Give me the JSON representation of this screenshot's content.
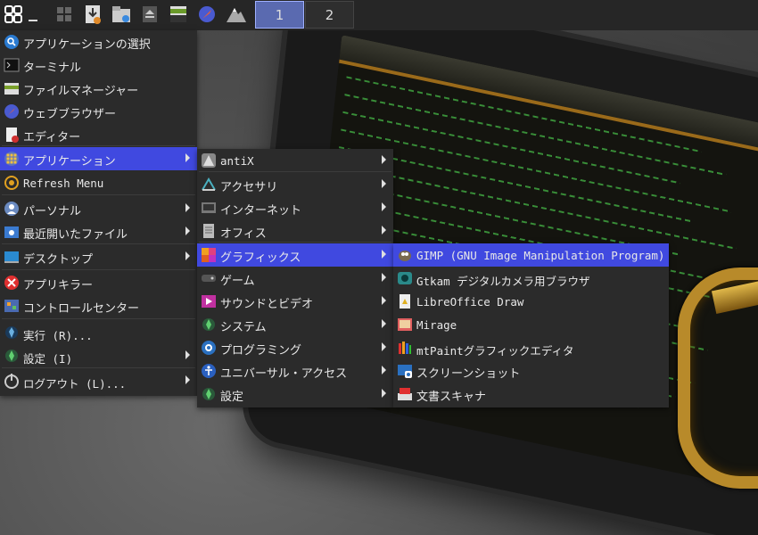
{
  "taskbar": {
    "launchers": [
      "menu-icon",
      "show-desktop-icon",
      "download-icon",
      "file-manager-icon",
      "eject-icon",
      "terminal-icon",
      "browser-icon",
      "mountain-icon"
    ],
    "desktops": [
      "1",
      "2"
    ],
    "active_desktop": "1"
  },
  "main_menu": {
    "items": [
      {
        "label": "アプリケーションの選択",
        "icon": "search-icon",
        "submenu": false
      },
      {
        "label": "ターミナル",
        "icon": "terminal-icon",
        "submenu": false
      },
      {
        "label": "ファイルマネージャー",
        "icon": "file-manager-icon",
        "submenu": false
      },
      {
        "label": "ウェブブラウザー",
        "icon": "web-browser-icon",
        "submenu": false
      },
      {
        "label": "エディター",
        "icon": "editor-icon",
        "submenu": false
      },
      {
        "label": "アプリケーション",
        "icon": "applications-icon",
        "submenu": true,
        "highlighted": true
      },
      {
        "label": "Refresh Menu",
        "icon": "refresh-icon",
        "submenu": false
      },
      {
        "label": "パーソナル",
        "icon": "personal-icon",
        "submenu": true
      },
      {
        "label": "最近開いたファイル",
        "icon": "recent-files-icon",
        "submenu": true
      },
      {
        "label": "デスクトップ",
        "icon": "desktop-icon",
        "submenu": true
      },
      {
        "label": "アプリキラー",
        "icon": "app-killer-icon",
        "submenu": false
      },
      {
        "label": "コントロールセンター",
        "icon": "control-center-icon",
        "submenu": false
      },
      {
        "label": "実行 (R)...",
        "icon": "run-icon",
        "submenu": false
      },
      {
        "label": "設定 (I)",
        "icon": "settings-icon",
        "submenu": true
      },
      {
        "label": "ログアウト (L)...",
        "icon": "logout-icon",
        "submenu": true
      }
    ]
  },
  "apps_menu": {
    "items": [
      {
        "label": "antiX",
        "icon": "antix-icon"
      },
      {
        "label": "アクセサリ",
        "icon": "accessories-icon"
      },
      {
        "label": "インターネット",
        "icon": "internet-icon"
      },
      {
        "label": "オフィス",
        "icon": "office-icon"
      },
      {
        "label": "グラフィックス",
        "icon": "graphics-icon",
        "highlighted": true
      },
      {
        "label": "ゲーム",
        "icon": "games-icon"
      },
      {
        "label": "サウンドとビデオ",
        "icon": "sound-video-icon"
      },
      {
        "label": "システム",
        "icon": "system-icon"
      },
      {
        "label": "プログラミング",
        "icon": "programming-icon"
      },
      {
        "label": "ユニバーサル・アクセス",
        "icon": "accessibility-icon"
      },
      {
        "label": "設定",
        "icon": "settings-icon"
      }
    ]
  },
  "graphics_menu": {
    "items": [
      {
        "label": "GIMP (GNU Image Manipulation Program)",
        "icon": "gimp-icon",
        "highlighted": true
      },
      {
        "label": "Gtkam デジタルカメラ用ブラウザ",
        "icon": "camera-icon"
      },
      {
        "label": "LibreOffice Draw",
        "icon": "libreoffice-draw-icon"
      },
      {
        "label": "Mirage",
        "icon": "image-viewer-icon"
      },
      {
        "label": "mtPaintグラフィックエディタ",
        "icon": "paint-icon"
      },
      {
        "label": "スクリーンショット",
        "icon": "screenshot-icon"
      },
      {
        "label": "文書スキャナ",
        "icon": "scanner-icon"
      }
    ]
  },
  "colors": {
    "menu_bg": "#2b2b2b",
    "highlight": "#4049e0",
    "taskbar_bg": "#262626",
    "desktop_active": "#5a6ab0"
  }
}
